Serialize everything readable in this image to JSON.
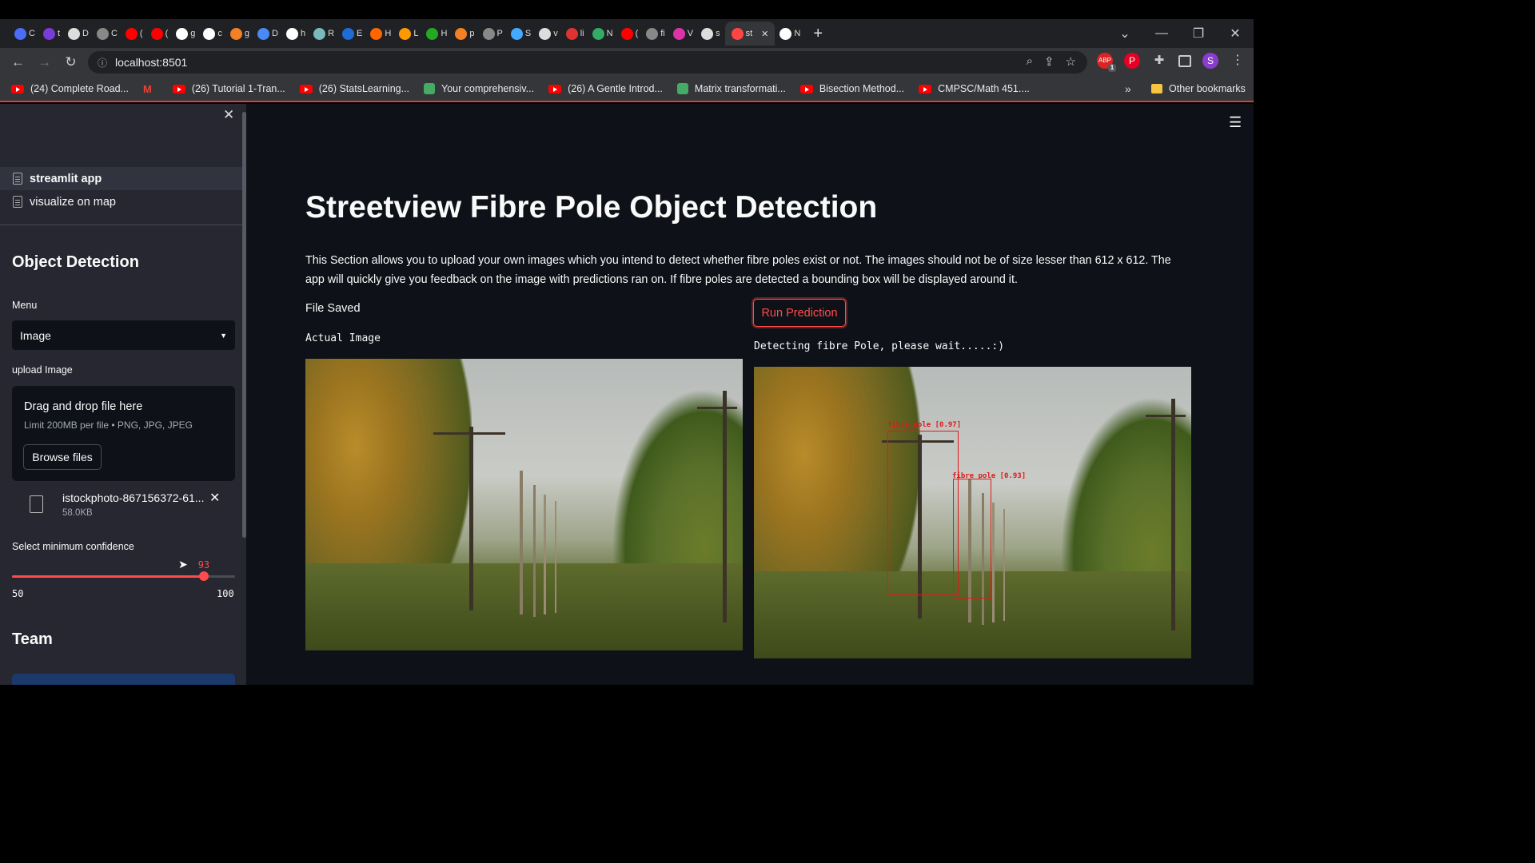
{
  "browser": {
    "tabs": [
      {
        "label": "C",
        "color": "#4a6cf7"
      },
      {
        "label": "t",
        "color": "#7a3cd6"
      },
      {
        "label": "D",
        "color": "#ddd"
      },
      {
        "label": "C",
        "color": "#888"
      },
      {
        "label": "(",
        "color": "#f00"
      },
      {
        "label": "(",
        "color": "#f00"
      },
      {
        "label": "g",
        "color": "#fff"
      },
      {
        "label": "c",
        "color": "#fff"
      },
      {
        "label": "g",
        "color": "#f48024"
      },
      {
        "label": "D",
        "color": "#4a8af4"
      },
      {
        "label": "h",
        "color": "#fff"
      },
      {
        "label": "R",
        "color": "#7bb"
      },
      {
        "label": "E",
        "color": "#1e6cd6"
      },
      {
        "label": "H",
        "color": "#f60"
      },
      {
        "label": "L",
        "color": "#f90"
      },
      {
        "label": "H",
        "color": "#2a2"
      },
      {
        "label": "p",
        "color": "#f48024"
      },
      {
        "label": "P",
        "color": "#888"
      },
      {
        "label": "S",
        "color": "#4af"
      },
      {
        "label": "v",
        "color": "#ddd"
      },
      {
        "label": "li",
        "color": "#d33"
      },
      {
        "label": "N",
        "color": "#3a6"
      },
      {
        "label": "(",
        "color": "#f00"
      },
      {
        "label": "fi",
        "color": "#888"
      },
      {
        "label": "V",
        "color": "#d3a"
      },
      {
        "label": "s",
        "color": "#ddd"
      },
      {
        "label": "st",
        "color": "#f44",
        "active": true
      },
      {
        "label": "N",
        "color": "#fff"
      }
    ],
    "new_tab": "+",
    "url": "localhost:8501",
    "bookmarks": [
      {
        "label": "(24) Complete Road...",
        "icon": "youtube-icon"
      },
      {
        "label": "",
        "icon": "gmail-icon"
      },
      {
        "label": "(26) Tutorial 1-Tran...",
        "icon": "youtube-icon"
      },
      {
        "label": "(26) StatsLearning...",
        "icon": "youtube-icon"
      },
      {
        "label": "Your comprehensiv...",
        "icon": "site-icon"
      },
      {
        "label": "(26) A Gentle Introd...",
        "icon": "youtube-icon"
      },
      {
        "label": "Matrix transformati...",
        "icon": "site-icon"
      },
      {
        "label": "Bisection Method...",
        "icon": "youtube-icon"
      },
      {
        "label": "CMPSC/Math 451....",
        "icon": "youtube-icon"
      }
    ],
    "more_bookmarks": "»",
    "other_bookmarks": "Other bookmarks",
    "profile_initial": "S",
    "abp_badge": "1"
  },
  "sidebar": {
    "pages": [
      {
        "label": "streamlit app",
        "active": true
      },
      {
        "label": "visualize on map",
        "active": false
      }
    ],
    "section_title": "Object Detection",
    "menu_label": "Menu",
    "menu_value": "Image",
    "upload_label": "upload Image",
    "dropzone_title": "Drag and drop file here",
    "dropzone_limit": "Limit 200MB per file • PNG, JPG, JPEG",
    "browse_label": "Browse files",
    "file_name": "istockphoto-867156372-61...",
    "file_size": "58.0KB",
    "confidence_label": "Select minimum confidence",
    "confidence_value": "93",
    "confidence_fraction": 0.86,
    "confidence_min": "50",
    "confidence_max": "100",
    "team_title": "Team"
  },
  "main": {
    "title": "Streetview Fibre Pole Object Detection",
    "description": "This Section allows you to upload your own images which you intend to detect whether fibre poles exist or not. The images should not be of size lesser than 612 x 612. The app will quickly give you feedback on the image with predictions ran on. If fibre poles are detected a bounding box will be displayed around it.",
    "file_saved": "File Saved",
    "actual_image_label": "Actual Image",
    "run_button": "Run Prediction",
    "detecting_text": "Detecting fibre Pole, please wait.....:)",
    "detections": [
      {
        "label": "fibre pole [0.97]"
      },
      {
        "label": "fibre pole [0.93]"
      }
    ]
  },
  "colors": {
    "accent": "#ff4b4b",
    "app_bg": "#0e1117",
    "sidebar_bg": "#262730",
    "bbox": "#e01a1a"
  }
}
